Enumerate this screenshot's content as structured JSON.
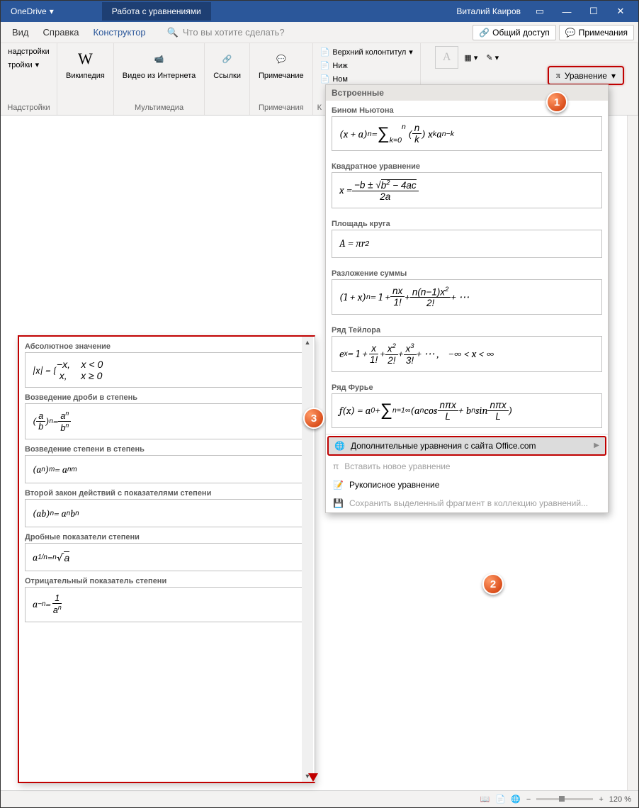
{
  "titlebar": {
    "onedrive": "OneDrive",
    "center_tab": "Работа с уравнениями",
    "user": "Виталий Каиров"
  },
  "menubar": {
    "tabs": [
      "Вид",
      "Справка",
      "Конструктор"
    ],
    "search_placeholder": "Что вы хотите сделать?",
    "share": "Общий доступ",
    "comments": "Примечания"
  },
  "ribbon": {
    "groups": [
      {
        "label": "Надстройки",
        "items": [
          "надстройки",
          "тройки"
        ]
      },
      {
        "label": "",
        "items": [
          {
            "label": "Википедия"
          }
        ]
      },
      {
        "label": "Мультимедиа",
        "items": [
          {
            "label": "Видео из Интернета"
          }
        ]
      },
      {
        "label": "",
        "items": [
          {
            "label": "Ссылки"
          }
        ]
      },
      {
        "label": "Примечания",
        "items": [
          {
            "label": "Примечание"
          }
        ]
      },
      {
        "label": "К",
        "items": [
          "Верхний колонтитул",
          "Ниж",
          "Ном"
        ]
      }
    ],
    "equation_btn": "Уравнение"
  },
  "eqpanel": {
    "header": "Встроенные",
    "items": [
      {
        "name": "Бином Ньютона",
        "formula": "binom"
      },
      {
        "name": "Квадратное уравнение",
        "formula": "quadratic"
      },
      {
        "name": "Площадь круга",
        "formula": "circle"
      },
      {
        "name": "Разложение суммы",
        "formula": "sumexp"
      },
      {
        "name": "Ряд Тейлора",
        "formula": "taylor"
      },
      {
        "name": "Ряд Фурье",
        "formula": "fourier"
      }
    ],
    "footer": {
      "more": "Дополнительные уравнения с сайта Office.com",
      "insert": "Вставить новое уравнение",
      "ink": "Рукописное уравнение",
      "save": "Сохранить выделенный фрагмент в коллекцию уравнений..."
    }
  },
  "subpanel": {
    "items": [
      {
        "name": "Абсолютное значение",
        "formula": "abs"
      },
      {
        "name": "Возведение дроби в степень",
        "formula": "fracpow"
      },
      {
        "name": "Возведение степени в степень",
        "formula": "powpow"
      },
      {
        "name": "Второй закон действий с показателями степени",
        "formula": "prodpow"
      },
      {
        "name": "Дробные показатели степени",
        "formula": "fracexp"
      },
      {
        "name": "Отрицательный показатель степени",
        "formula": "negexp"
      }
    ]
  },
  "statusbar": {
    "zoom": "120 %"
  },
  "badges": {
    "b1": "1",
    "b2": "2",
    "b3": "3"
  }
}
